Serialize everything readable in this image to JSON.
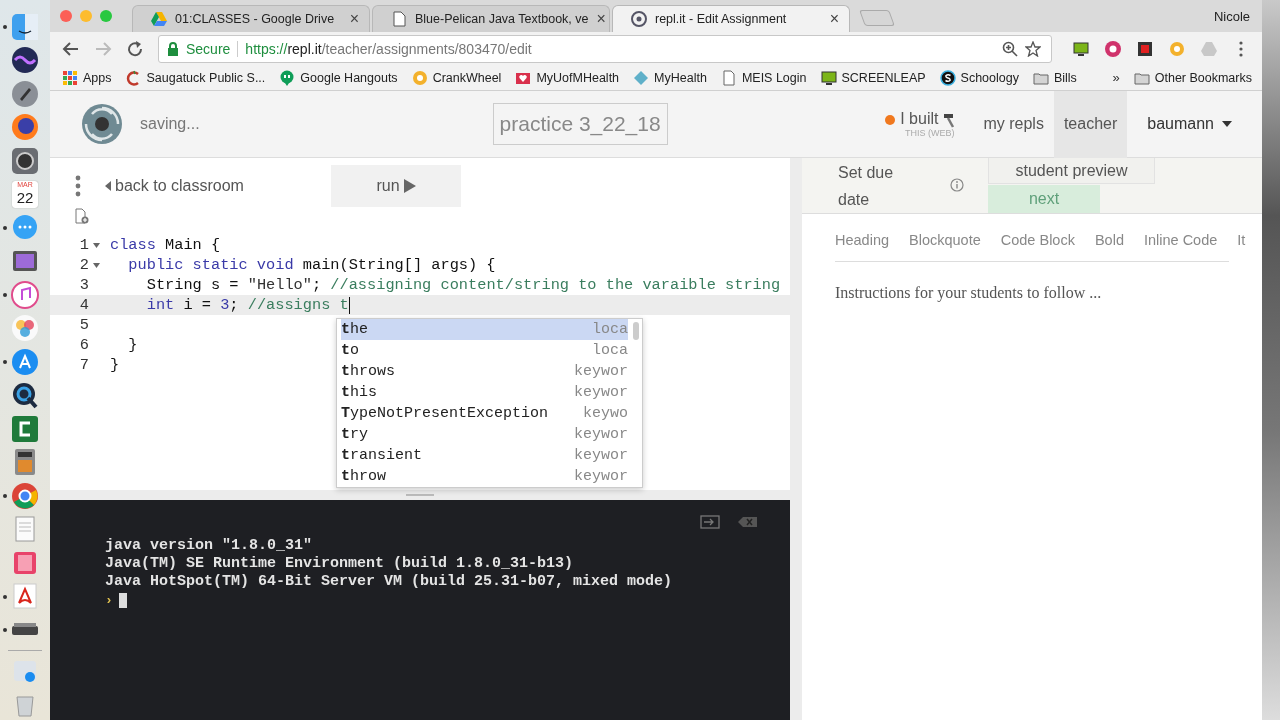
{
  "dock": [
    {
      "running": true
    },
    {
      "running": false
    },
    {
      "running": false
    },
    {
      "running": false
    },
    {
      "running": false
    },
    {
      "running": false,
      "month": "MAR",
      "day": "22"
    },
    {
      "running": true
    },
    {
      "running": false
    },
    {
      "running": true
    },
    {
      "running": false
    },
    {
      "running": true
    },
    {
      "running": false
    },
    {
      "running": false
    },
    {
      "running": false
    },
    {
      "running": true
    },
    {
      "running": false
    },
    {
      "running": false
    },
    {
      "running": true
    },
    {
      "running": true
    },
    {
      "running": false
    },
    {
      "running": false
    }
  ],
  "browser": {
    "tabs": [
      {
        "title": "01:CLASSES - Google Drive",
        "close": "×",
        "selected": false
      },
      {
        "title": "Blue-Pelican Java Textbook, ve",
        "close": "×",
        "selected": false
      },
      {
        "title": "repl.it - Edit Assignment",
        "close": "×",
        "selected": true
      }
    ],
    "profile": "Nicole",
    "security": "Secure",
    "url_scheme": "https://",
    "url_host": "repl.it",
    "url_path": "/teacher/assignments/803470/edit",
    "bookmarks": [
      {
        "label": "Apps"
      },
      {
        "label": "Saugatuck Public S..."
      },
      {
        "label": "Google Hangouts"
      },
      {
        "label": "CrankWheel"
      },
      {
        "label": "MyUofMHealth"
      },
      {
        "label": "MyHealth"
      },
      {
        "label": "MEIS Login"
      },
      {
        "label": "SCREENLEAP"
      },
      {
        "label": "Schoology"
      },
      {
        "label": "Bills"
      }
    ],
    "more_bookmarks": "»",
    "other_bookmarks": "Other Bookmarks"
  },
  "header": {
    "status": "saving...",
    "title": "practice 3_22_18",
    "built_label": "I built",
    "built_sub": "THIS (WEB)",
    "nav": [
      {
        "label": "my repls",
        "selected": false
      },
      {
        "label": "teacher",
        "selected": true
      }
    ],
    "user": "baumann"
  },
  "editor": {
    "back_link": "back to classroom",
    "run_button": "run",
    "lines": [
      {
        "number": "1",
        "fold": true,
        "active": false,
        "tokens": [
          {
            "kind": "keyword",
            "text": "class"
          },
          {
            "kind": "plain",
            "text": " Main {"
          }
        ]
      },
      {
        "number": "2",
        "fold": true,
        "active": false,
        "tokens": [
          {
            "kind": "keyword",
            "text": "  public static void"
          },
          {
            "kind": "plain",
            "text": " main(String[] args) {"
          }
        ]
      },
      {
        "number": "3",
        "fold": false,
        "active": false,
        "tokens": [
          {
            "kind": "plain",
            "text": "    String s = "
          },
          {
            "kind": "string",
            "text": "\"Hello\""
          },
          {
            "kind": "plain",
            "text": "; "
          },
          {
            "kind": "comment",
            "text": "//assigning content/string to the varaible string"
          }
        ]
      },
      {
        "number": "4",
        "fold": false,
        "active": true,
        "tokens": [
          {
            "kind": "keyword",
            "text": "    int"
          },
          {
            "kind": "plain",
            "text": " i = "
          },
          {
            "kind": "number",
            "text": "3"
          },
          {
            "kind": "plain",
            "text": "; "
          },
          {
            "kind": "comment",
            "text": "//assigns t"
          }
        ]
      },
      {
        "number": "5",
        "fold": false,
        "active": false
      },
      {
        "number": "6",
        "fold": false,
        "active": false,
        "tokens": [
          {
            "kind": "plain",
            "text": "  }"
          }
        ]
      },
      {
        "number": "7",
        "fold": false,
        "active": false,
        "tokens": [
          {
            "kind": "plain",
            "text": "}"
          }
        ]
      }
    ],
    "autocomplete": [
      {
        "text": "**t**he",
        "meta": "loca",
        "selected": true
      },
      {
        "text": "**t**o",
        "meta": "loca",
        "selected": false
      },
      {
        "text": "**t**hrows",
        "meta": "keywor",
        "selected": false
      },
      {
        "text": "**t**his",
        "meta": "keywor",
        "selected": false
      },
      {
        "text": "**T**ypeNotPresentException",
        "meta": "keywo",
        "selected": false
      },
      {
        "text": "**t**ry",
        "meta": "keywor",
        "selected": false
      },
      {
        "text": "**t**ransient",
        "meta": "keywor",
        "selected": false
      },
      {
        "text": "**t**hrow",
        "meta": "keywor",
        "selected": false
      }
    ]
  },
  "console": {
    "lines": [
      "java version \"1.8.0_31\"",
      "Java(TM) SE Runtime Environment (build 1.8.0_31-b13)",
      "Java HotSpot(TM) 64-Bit Server VM (build 25.31-b07, mixed mode)"
    ],
    "prompt": "›"
  },
  "instructions": {
    "due_date_label": "Set due date",
    "preview_button": "student preview",
    "next_button": "next",
    "toolbar": [
      "Heading",
      "Blockquote",
      "Code Block",
      "Bold",
      "Inline Code",
      "It"
    ],
    "placeholder": "Instructions for your students to follow ..."
  }
}
